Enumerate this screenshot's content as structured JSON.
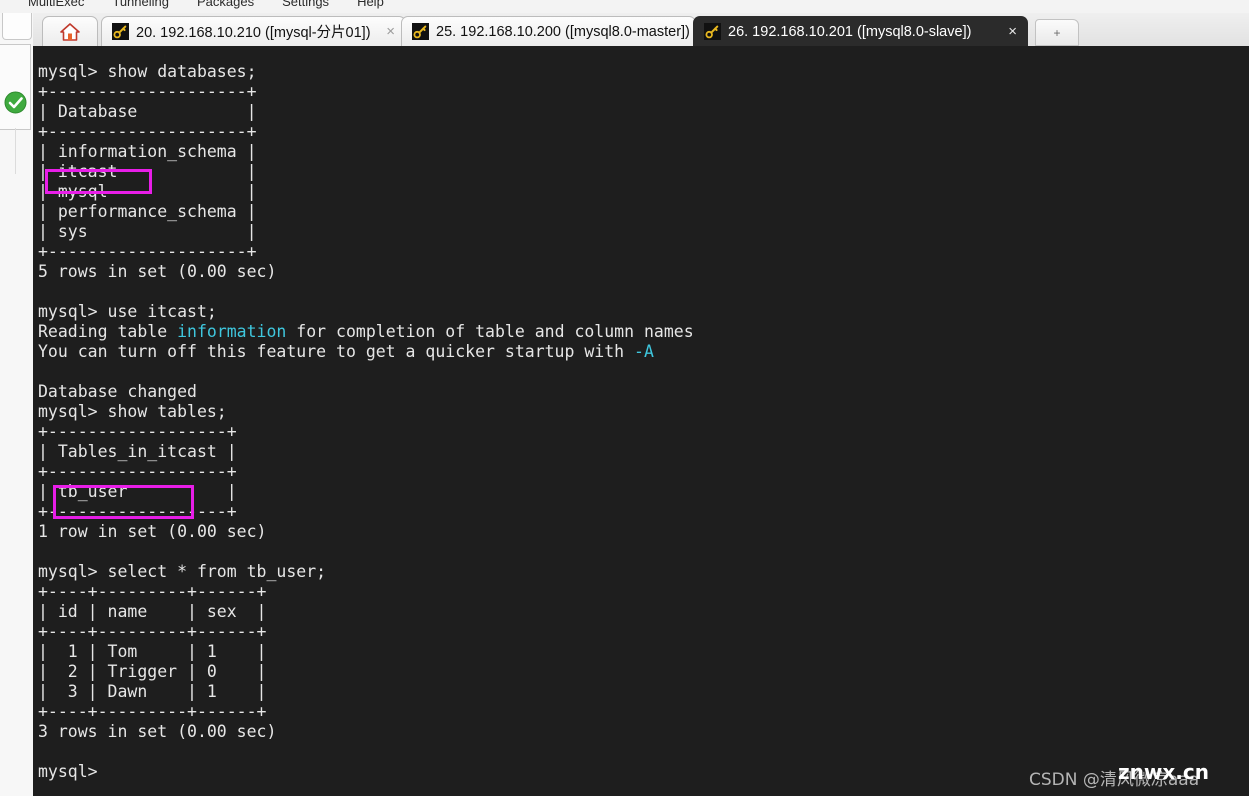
{
  "menubar": {
    "items": [
      {
        "label": "MultiExec"
      },
      {
        "label": "Tunneling"
      },
      {
        "label": "Packages"
      },
      {
        "label": "Settings"
      },
      {
        "label": "Help"
      }
    ]
  },
  "sidebar": {
    "status_icon": "check-circle-icon",
    "status_color": "#3faa3f"
  },
  "tabs": {
    "home_label": "",
    "home_icon": "home-icon",
    "new_tab_label": "+",
    "items": [
      {
        "label": "20.  192.168.10.210  ([mysql-分片01])",
        "icon": "key-icon",
        "close": "×",
        "active": false
      },
      {
        "label": "25.  192.168.10.200  ([mysql8.0-master])",
        "icon": "key-icon",
        "close": "×",
        "active": false
      },
      {
        "label": "26.  192.168.10.201  ([mysql8.0-slave])",
        "icon": "key-icon",
        "close": "×",
        "active": true
      }
    ]
  },
  "terminal": {
    "background": "#1e1e1e",
    "foreground": "#e6e6e6",
    "accent_cyan": "#3fc7de",
    "highlight_color": "#e81ee8",
    "lines_part1": "mysql> show databases;\n+--------------------+\n| Database           |\n+--------------------+\n| information_schema |\n| itcast             |\n| mysql              |\n| performance_schema |\n| sys                |\n+--------------------+\n5 rows in set (0.00 sec)\n\nmysql> use itcast;\nReading table ",
    "cyan1": "information",
    "lines_part2": " for completion of table and column names\nYou can turn off this feature to get a quicker startup with ",
    "cyan2": "-A",
    "lines_part3": "\n\nDatabase changed\nmysql> show tables;\n+------------------+\n| Tables_in_itcast |\n+------------------+\n| tb_user          |\n+------------------+\n1 row in set (0.00 sec)\n\nmysql> select * from tb_user;\n+----+---------+------+\n| id | name    | sex  |\n+----+---------+------+\n|  1 | Tom     | 1    |\n|  2 | Trigger | 0    |\n|  3 | Dawn    | 1    |\n+----+---------+------+\n3 rows in set (0.00 sec)\n\nmysql>",
    "highlights": [
      {
        "target": "itcast",
        "box": "b1"
      },
      {
        "target": "tb_user",
        "box": "b2"
      }
    ]
  },
  "watermark": {
    "line_a": "CSDN @清风微凉aaa",
    "line_b": "znwx.cn"
  }
}
